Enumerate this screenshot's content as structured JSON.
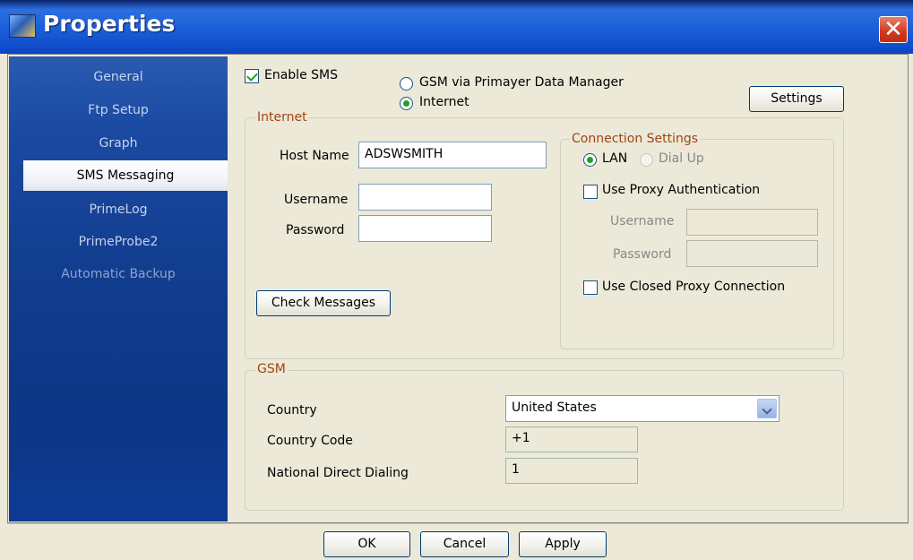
{
  "window": {
    "title": "Properties"
  },
  "sidebar": {
    "items": [
      {
        "label": "General"
      },
      {
        "label": "Ftp Setup"
      },
      {
        "label": "Graph"
      },
      {
        "label": "SMS Messaging"
      },
      {
        "label": "PrimeLog"
      },
      {
        "label": "PrimeProbe2"
      },
      {
        "label": "Automatic Backup"
      }
    ],
    "active": "SMS Messaging"
  },
  "sms": {
    "enable_label": "Enable SMS",
    "enable_checked": true,
    "mode_options": [
      "GSM via Primayer Data Manager",
      "Internet"
    ],
    "mode_selected": "Internet",
    "settings_label": "Settings"
  },
  "internet": {
    "legend": "Internet",
    "host_label": "Host Name",
    "host_value": "ADSWSMITH",
    "username_label": "Username",
    "username_value": "",
    "password_label": "Password",
    "password_value": "",
    "check_label": "Check Messages"
  },
  "connection": {
    "legend": "Connection Settings",
    "lan_label": "LAN",
    "dialup_label": "Dial Up",
    "selected": "LAN",
    "proxy_auth_label": "Use Proxy Authentication",
    "proxy_auth_checked": false,
    "proxy_username_label": "Username",
    "proxy_password_label": "Password",
    "closed_proxy_label": "Use Closed Proxy Connection",
    "closed_proxy_checked": false
  },
  "gsm": {
    "legend": "GSM",
    "country_label": "Country",
    "country_value": "United States",
    "country_code_label": "Country Code",
    "country_code_value": "+1",
    "ndd_label": "National Direct Dialing",
    "ndd_value": "1"
  },
  "footer": {
    "ok_label": "OK",
    "cancel_label": "Cancel",
    "apply_label": "Apply"
  }
}
